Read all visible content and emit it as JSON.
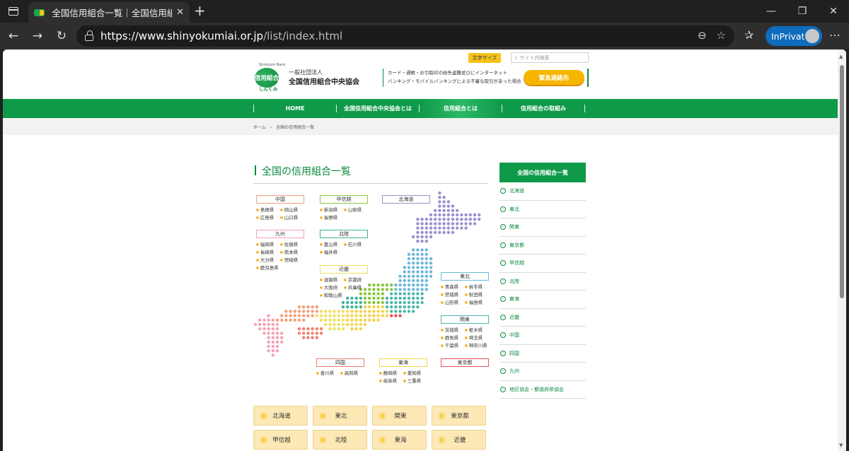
{
  "browser": {
    "tab_title": "全国信用組合一覧｜全国信用組合",
    "url_host": "https://www.shinyokumiai.or.jp",
    "url_path": "/list/index.html",
    "inprivate_label": "InPrivate"
  },
  "header": {
    "logo_small": "Shinkumi Bank",
    "logo_text": "信用組合",
    "logo_kana": "しんくみ",
    "org_small": "一般社団法人",
    "org_name": "全国信用組合中央協会",
    "font_size_label": "文字サイズ",
    "search_placeholder": "サイト内検索",
    "notice_line1": "カード・通帳・お引取印の紛失盗難並びにインターネット",
    "notice_line2": "バンキング・モバイルバンキングによる不審な取引があった場合",
    "emergency_label": "緊急連絡先"
  },
  "nav": {
    "items": [
      "HOME",
      "全国信用組合中央協会とは",
      "信用組合とは",
      "信用組合の取組み"
    ]
  },
  "breadcrumb": {
    "home": "ホーム",
    "sep": "›",
    "current": "全国の信用組合一覧"
  },
  "main": {
    "title": "全国の信用組合一覧"
  },
  "map": {
    "regions": [
      {
        "name": "中国",
        "color": "#f4a07a",
        "prefs": [
          "島根県",
          "岡山県",
          "広島県",
          "山口県"
        ]
      },
      {
        "name": "甲信越",
        "color": "#8cc63f",
        "prefs": [
          "新潟県",
          "山梨県",
          "長野県"
        ]
      },
      {
        "name": "北海道",
        "color": "#9b8ecf",
        "prefs": []
      },
      {
        "name": "九州",
        "color": "#f4a3b5",
        "prefs": [
          "福岡県",
          "佐賀県",
          "長崎県",
          "熊本県",
          "大分県",
          "宮崎県",
          "鹿児島県"
        ]
      },
      {
        "name": "北陸",
        "color": "#3fb39a",
        "prefs": [
          "富山県",
          "石川県",
          "福井県"
        ]
      },
      {
        "name": "近畿",
        "color": "#f0e060",
        "prefs": [
          "滋賀県",
          "京都府",
          "大阪府",
          "兵庫県",
          "和歌山県"
        ]
      },
      {
        "name": "東北",
        "color": "#6fb8d8",
        "prefs": [
          "青森県",
          "岩手県",
          "宮城県",
          "秋田県",
          "山形県",
          "福島県"
        ]
      },
      {
        "name": "関東",
        "color": "#4db6ac",
        "prefs": [
          "茨城県",
          "栃木県",
          "群馬県",
          "埼玉県",
          "千葉県",
          "神奈川県"
        ]
      },
      {
        "name": "四国",
        "color": "#f08070",
        "prefs": [
          "香川県",
          "高知県"
        ]
      },
      {
        "name": "東海",
        "color": "#f5d34a",
        "prefs": [
          "静岡県",
          "愛知県",
          "岐阜県",
          "三重県"
        ]
      },
      {
        "name": "東京都",
        "color": "#e8505b",
        "prefs": []
      }
    ]
  },
  "region_buttons": [
    "北海道",
    "東北",
    "関東",
    "東京都",
    "甲信越",
    "北陸",
    "東海",
    "近畿"
  ],
  "sidebar": {
    "heading": "全国の信用組合一覧",
    "items": [
      "北海道",
      "東北",
      "関東",
      "東京都",
      "甲信越",
      "北陸",
      "東海",
      "近畿",
      "中国",
      "四国",
      "九州",
      "地区協会・都道府県協会"
    ]
  },
  "colors": {
    "brand_green": "#0f9a4a",
    "accent_yellow": "#f7b500"
  }
}
